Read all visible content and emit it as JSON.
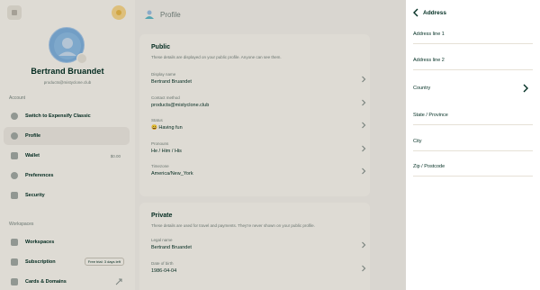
{
  "sidebar": {
    "user": {
      "name": "Bertrand Bruandet",
      "email": "products@mistyclone.club"
    },
    "account_label": "Account",
    "workspaces_label": "Workspaces",
    "items": [
      {
        "label": "Switch to Expensify Classic",
        "icon": "transfer-icon"
      },
      {
        "label": "Profile",
        "icon": "profile-icon",
        "active": true
      },
      {
        "label": "Wallet",
        "icon": "wallet-icon",
        "value": "$0.00"
      },
      {
        "label": "Preferences",
        "icon": "gear-icon"
      },
      {
        "label": "Security",
        "icon": "lock-icon"
      }
    ],
    "workspace_items": [
      {
        "label": "Workspaces",
        "icon": "building-icon"
      },
      {
        "label": "Subscription",
        "icon": "credit-card-icon",
        "badge": "Free trial: 3 days left"
      },
      {
        "label": "Cards & Domains",
        "icon": "card-icon"
      }
    ]
  },
  "main": {
    "title": "Profile",
    "public": {
      "title": "Public",
      "description": "These details are displayed on your public profile. Anyone can see them.",
      "fields": [
        {
          "label": "Display name",
          "value": "Bertrand Bruandet"
        },
        {
          "label": "Contact method",
          "value": "products@mistyclone.club"
        },
        {
          "label": "Status",
          "value": "😀 Having fun"
        },
        {
          "label": "Pronouns",
          "value": "He / Him / His"
        },
        {
          "label": "Timezone",
          "value": "America/New_York"
        }
      ]
    },
    "private": {
      "title": "Private",
      "description": "These details are used for travel and payments. They're never shown on your public profile.",
      "fields": [
        {
          "label": "Legal name",
          "value": "Bertrand Bruandet"
        },
        {
          "label": "Date of birth",
          "value": "1986-04-04"
        }
      ]
    }
  },
  "panel": {
    "title": "Address",
    "fields": [
      {
        "label": "Address line 1"
      },
      {
        "label": "Address line 2"
      },
      {
        "label": "Country",
        "has_chevron": true
      },
      {
        "label": "State / Province"
      },
      {
        "label": "City"
      },
      {
        "label": "Zip / Postcode"
      }
    ]
  },
  "colors": {
    "text": "#002e22",
    "muted": "#76847e",
    "background": "#f2efe8",
    "card": "#f8f4ec",
    "panel": "#ffffff",
    "accent": "#03d47c"
  }
}
